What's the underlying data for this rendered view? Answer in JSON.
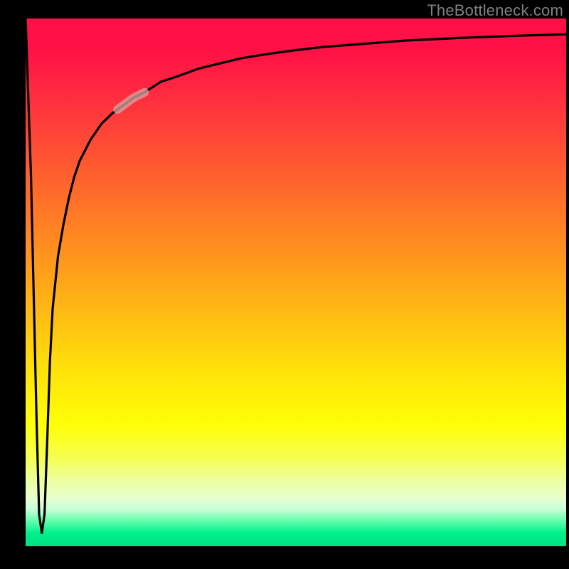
{
  "watermark": "TheBottleneck.com",
  "chart_data": {
    "type": "line",
    "title": "",
    "xlabel": "",
    "ylabel": "",
    "xlim": [
      0,
      100
    ],
    "ylim": [
      0,
      100
    ],
    "grid": false,
    "legend": false,
    "background_gradient": {
      "direction": "top-to-bottom",
      "stops": [
        {
          "pct": 0,
          "color": "#ff1146"
        },
        {
          "pct": 28,
          "color": "#ff5a30"
        },
        {
          "pct": 55,
          "color": "#ffb814"
        },
        {
          "pct": 77,
          "color": "#ffff06"
        },
        {
          "pct": 91,
          "color": "#e7ffd0"
        },
        {
          "pct": 100,
          "color": "#00e084"
        }
      ]
    },
    "series": [
      {
        "name": "bottleneck-curve",
        "color": "#000000",
        "x": [
          0.0,
          1.0,
          2.0,
          2.5,
          3.0,
          3.5,
          4.0,
          4.5,
          5.0,
          6.0,
          7.0,
          8.0,
          9.0,
          10.0,
          12.0,
          14.0,
          16.0,
          18.0,
          20.0,
          22.0,
          25.0,
          28.0,
          32.0,
          36.0,
          40.0,
          45.0,
          50.0,
          55.0,
          60.0,
          70.0,
          80.0,
          90.0,
          100.0
        ],
        "y": [
          100.0,
          70.0,
          25.0,
          6.0,
          2.5,
          6.0,
          20.0,
          35.0,
          45.0,
          55.0,
          61.0,
          66.0,
          70.0,
          73.0,
          77.0,
          80.0,
          82.0,
          83.5,
          85.0,
          86.0,
          88.0,
          89.0,
          90.5,
          91.5,
          92.5,
          93.3,
          94.0,
          94.6,
          95.0,
          95.8,
          96.3,
          96.7,
          97.0
        ]
      }
    ],
    "highlight_segment": {
      "series": "bottleneck-curve",
      "x_start": 17.0,
      "x_end": 22.0,
      "color": "#d6a6a2",
      "opacity": 0.75,
      "stroke_width": 12
    }
  }
}
